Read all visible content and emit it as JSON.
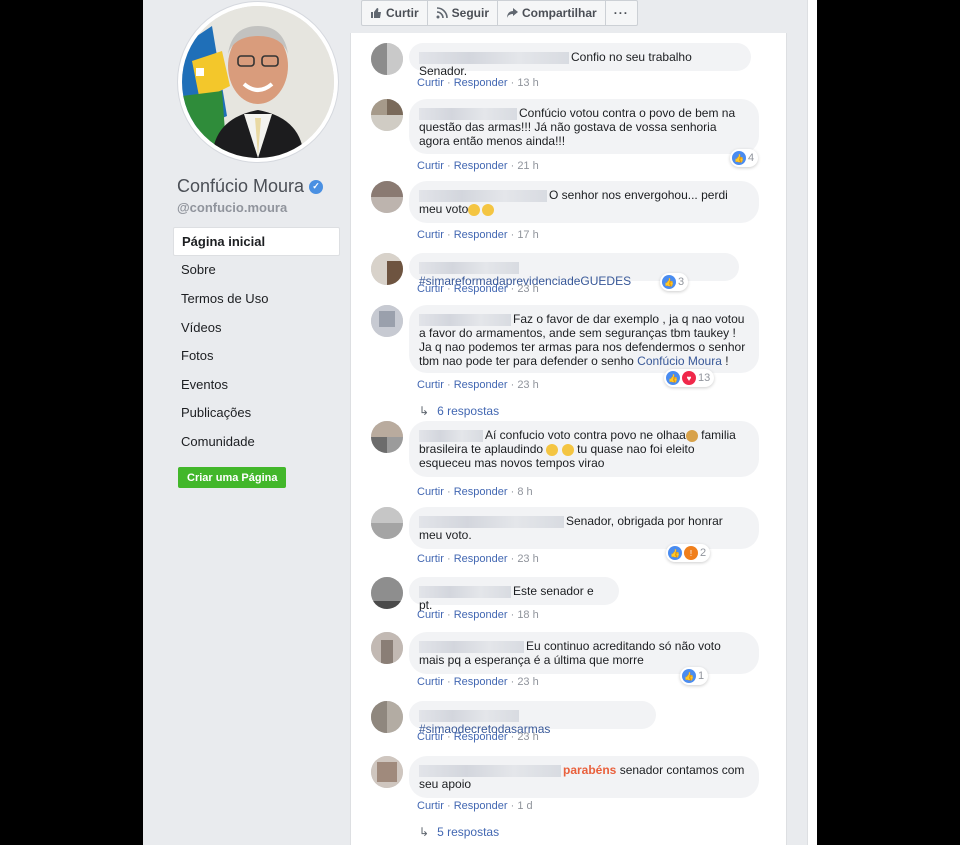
{
  "profile": {
    "name": "Confúcio Moura",
    "handle": "@confucio.moura"
  },
  "nav": [
    {
      "label": "Página inicial",
      "active": true
    },
    {
      "label": "Sobre"
    },
    {
      "label": "Termos de Uso"
    },
    {
      "label": "Vídeos"
    },
    {
      "label": "Fotos"
    },
    {
      "label": "Eventos"
    },
    {
      "label": "Publicações"
    },
    {
      "label": "Comunidade"
    }
  ],
  "create_page_label": "Criar uma Página",
  "actionbar": {
    "like": "Curtir",
    "follow": "Seguir",
    "share": "Compartilhar",
    "more": "···"
  },
  "labels": {
    "like": "Curtir",
    "reply": "Responder",
    "sep": "·"
  },
  "comments": [
    {
      "text": "Confio no seu trabalho Senador.",
      "time": "13 h"
    },
    {
      "text": "Confúcio votou contra o povo de bem na questão das armas!!! Já não gostava de vossa senhoria agora então menos ainda!!!",
      "time": "21 h",
      "reactions": "4"
    },
    {
      "text": "O senhor nos envergohou... perdi meu voto",
      "time": "17 h"
    },
    {
      "text": "#simareformadaprevidenciadeGUEDES",
      "time": "23 h",
      "reactions": "3"
    },
    {
      "text_a": "Faz o favor de dar exemplo , ja q nao votou a favor do armamentos, ande sem seguranças tbm taukey ! Ja q nao podemos ter armas para nos defendermos o senhor tbm nao pode ter para defender o senho",
      "tag": "Confúcio Moura",
      "text_b": " !",
      "time": "23 h",
      "reactions": "13",
      "replies": "6 respostas"
    },
    {
      "text_a": "Aí confucio voto contra povo ne olhaa",
      "text_b": " familia brasileira te aplaudindo",
      "text_c": " tu quase nao foi eleito esqueceu mas novos tempos virao",
      "time": "8 h"
    },
    {
      "text": "Senador, obrigada por honrar meu voto.",
      "time": "23 h",
      "reactions": "2"
    },
    {
      "text": "Este senador e pt.",
      "time": "18 h"
    },
    {
      "text": "Eu continuo acreditando só não voto mais pq a esperança é a última que morre",
      "time": "23 h",
      "reactions": "1"
    },
    {
      "text": "#simaodecretodasarmas",
      "time": "23 h"
    },
    {
      "hl": "parabéns",
      "text": " senador contamos com seu apoio",
      "time": "1 d",
      "replies": "5 respostas"
    }
  ],
  "colors": {
    "link": "#4267b2",
    "hashtag": "#385898",
    "accent_green": "#42b72a",
    "highlight": "#e9603c"
  }
}
